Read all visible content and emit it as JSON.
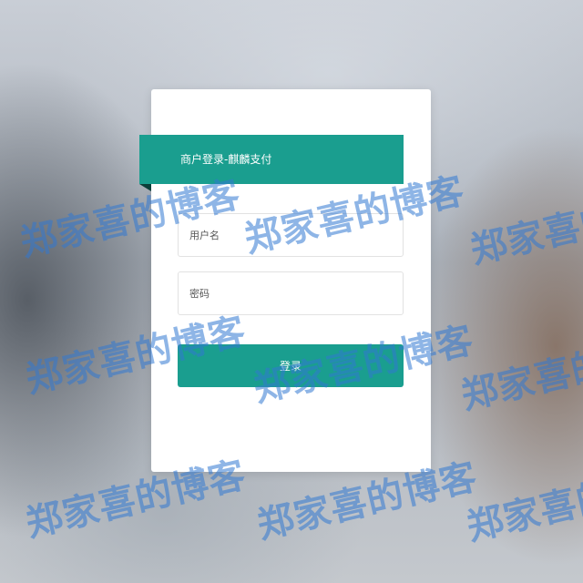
{
  "login": {
    "title": "商户登录-麒麟支付",
    "username_placeholder": "用户名",
    "password_placeholder": "密码",
    "submit_label": "登录"
  },
  "watermark": {
    "text": "郑家喜的博客"
  },
  "colors": {
    "accent": "#1a9e8f",
    "watermark": "#3278d2"
  }
}
